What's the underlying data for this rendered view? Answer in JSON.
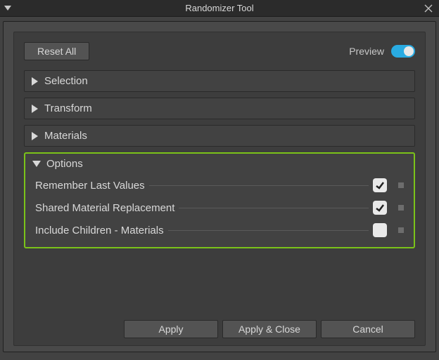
{
  "window": {
    "title": "Randomizer Tool"
  },
  "toolbar": {
    "reset_all": "Reset All",
    "preview_label": "Preview",
    "preview_on": true
  },
  "sections": {
    "selection": {
      "label": "Selection",
      "expanded": false
    },
    "transform": {
      "label": "Transform",
      "expanded": false
    },
    "materials": {
      "label": "Materials",
      "expanded": false
    },
    "options": {
      "label": "Options",
      "expanded": true,
      "items": [
        {
          "label": "Remember Last Values",
          "checked": true
        },
        {
          "label": "Shared Material Replacement",
          "checked": true
        },
        {
          "label": "Include Children - Materials",
          "checked": false
        }
      ]
    }
  },
  "footer": {
    "apply": "Apply",
    "apply_close": "Apply & Close",
    "cancel": "Cancel"
  }
}
